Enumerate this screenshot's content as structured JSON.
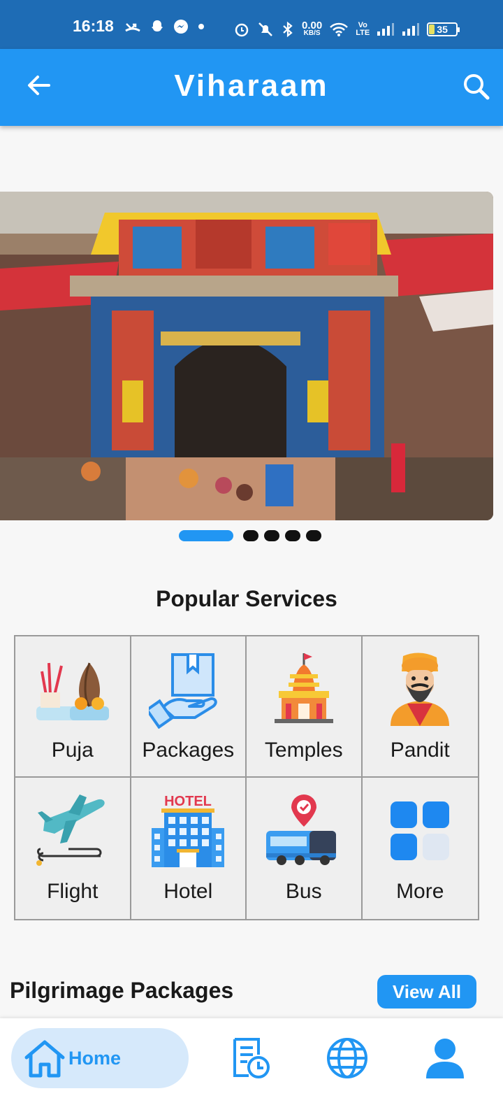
{
  "status_bar": {
    "time": "16:18",
    "net_speed_top": "0.00",
    "net_speed_bottom": "KB/S",
    "volte_top": "Vo",
    "volte_bottom": "LTE",
    "battery": "35"
  },
  "app_bar": {
    "title": "Viharaam"
  },
  "carousel": {
    "page_count": 5,
    "active_index": 0
  },
  "services": {
    "title": "Popular Services",
    "items": [
      {
        "label": "Puja",
        "icon": "puja-icon"
      },
      {
        "label": "Packages",
        "icon": "package-icon"
      },
      {
        "label": "Temples",
        "icon": "temple-icon"
      },
      {
        "label": "Pandit",
        "icon": "pandit-icon"
      },
      {
        "label": "Flight",
        "icon": "flight-icon"
      },
      {
        "label": "Hotel",
        "icon": "hotel-icon"
      },
      {
        "label": "Bus",
        "icon": "bus-icon"
      },
      {
        "label": "More",
        "icon": "more-icon"
      }
    ],
    "hotel_sign": "HOTEL"
  },
  "packages": {
    "title": "Pilgrimage Packages",
    "view_all": "View All"
  },
  "bottom_nav": {
    "home": "Home",
    "items": [
      "home-icon",
      "bookings-icon",
      "globe-icon",
      "profile-icon"
    ]
  },
  "colors": {
    "primary": "#2196f3",
    "status_bar": "#1e6cb5"
  }
}
